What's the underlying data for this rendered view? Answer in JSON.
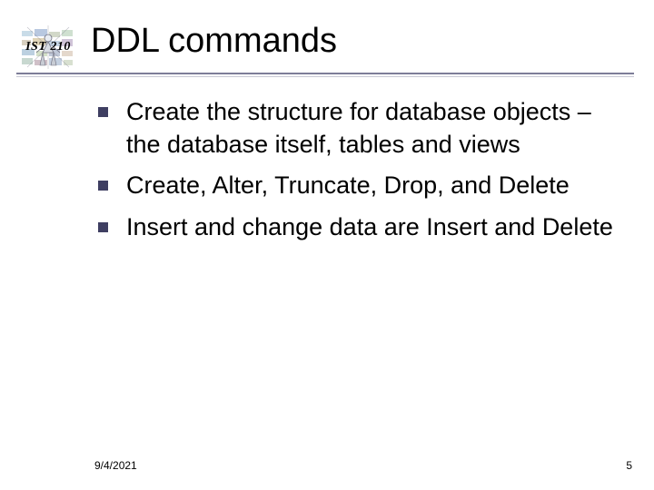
{
  "header": {
    "logo_label": "IST 210",
    "title": "DDL commands"
  },
  "bullets": [
    "Create the structure for database objects – the database itself, tables and views",
    "Create, Alter, Truncate, Drop, and Delete",
    "Insert and change data are Insert and Delete"
  ],
  "footer": {
    "date": "9/4/2021",
    "page": "5"
  }
}
